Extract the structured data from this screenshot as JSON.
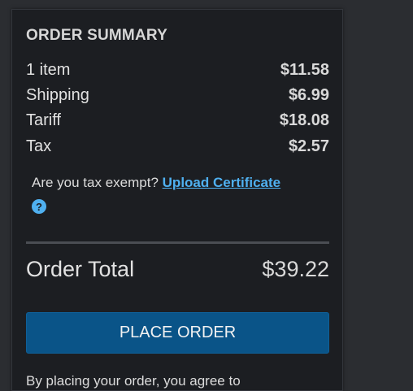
{
  "summary": {
    "title": "ORDER SUMMARY",
    "lines": [
      {
        "label": "1 item",
        "amount": "$11.58"
      },
      {
        "label": "Shipping",
        "amount": "$6.99"
      },
      {
        "label": "Tariff",
        "amount": "$18.08"
      },
      {
        "label": "Tax",
        "amount": "$2.57"
      }
    ],
    "tax_exempt_question": "Are you tax exempt?",
    "upload_link": "Upload Certificate",
    "help_glyph": "?",
    "total_label": "Order Total",
    "total_amount": "$39.22",
    "place_order": "PLACE ORDER",
    "legal_text": "By placing your order, you agree to"
  },
  "colors": {
    "panel": "#1c1e22",
    "link": "#4fb0f0",
    "button": "#0a5488"
  }
}
